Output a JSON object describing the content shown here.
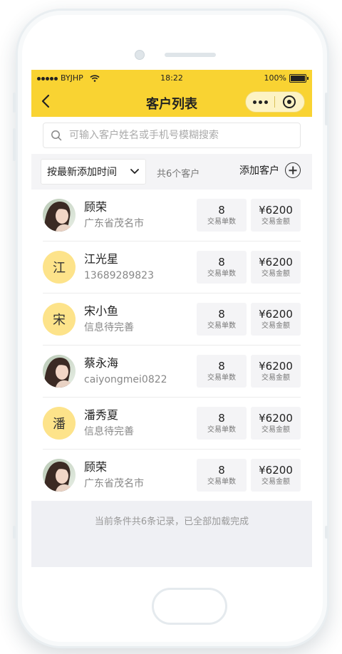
{
  "status_bar": {
    "carrier": "BYJHP",
    "time": "18:22",
    "battery": "100%"
  },
  "nav": {
    "title": "客户列表"
  },
  "search": {
    "placeholder": "可输入客户姓名或手机号模糊搜索"
  },
  "filter": {
    "sort_label": "按最新添加时间",
    "count_text": "共6个客户",
    "add_label": "添加客户"
  },
  "stat_labels": {
    "trades": "交易单数",
    "amount": "交易金额"
  },
  "customers": [
    {
      "name": "顾荣",
      "sub": "广东省茂名市",
      "avatar": "photo",
      "trades": "8",
      "amount": "¥6200"
    },
    {
      "name": "江光星",
      "sub": "13689289823",
      "avatar": "江",
      "trades": "8",
      "amount": "¥6200"
    },
    {
      "name": "宋小鱼",
      "sub": "信息待完善",
      "avatar": "宋",
      "trades": "8",
      "amount": "¥6200"
    },
    {
      "name": "蔡永海",
      "sub": "caiyongmei0822",
      "avatar": "photo",
      "trades": "8",
      "amount": "¥6200"
    },
    {
      "name": "潘秀夏",
      "sub": "信息待完善",
      "avatar": "潘",
      "trades": "8",
      "amount": "¥6200"
    },
    {
      "name": "顾荣",
      "sub": "广东省茂名市",
      "avatar": "photo",
      "trades": "8",
      "amount": "¥6200"
    }
  ],
  "footer_text": "当前条件共6条记录，已全部加载完成",
  "colors": {
    "accent": "#f9d332",
    "avatar_letter_bg": "#fde38a"
  }
}
